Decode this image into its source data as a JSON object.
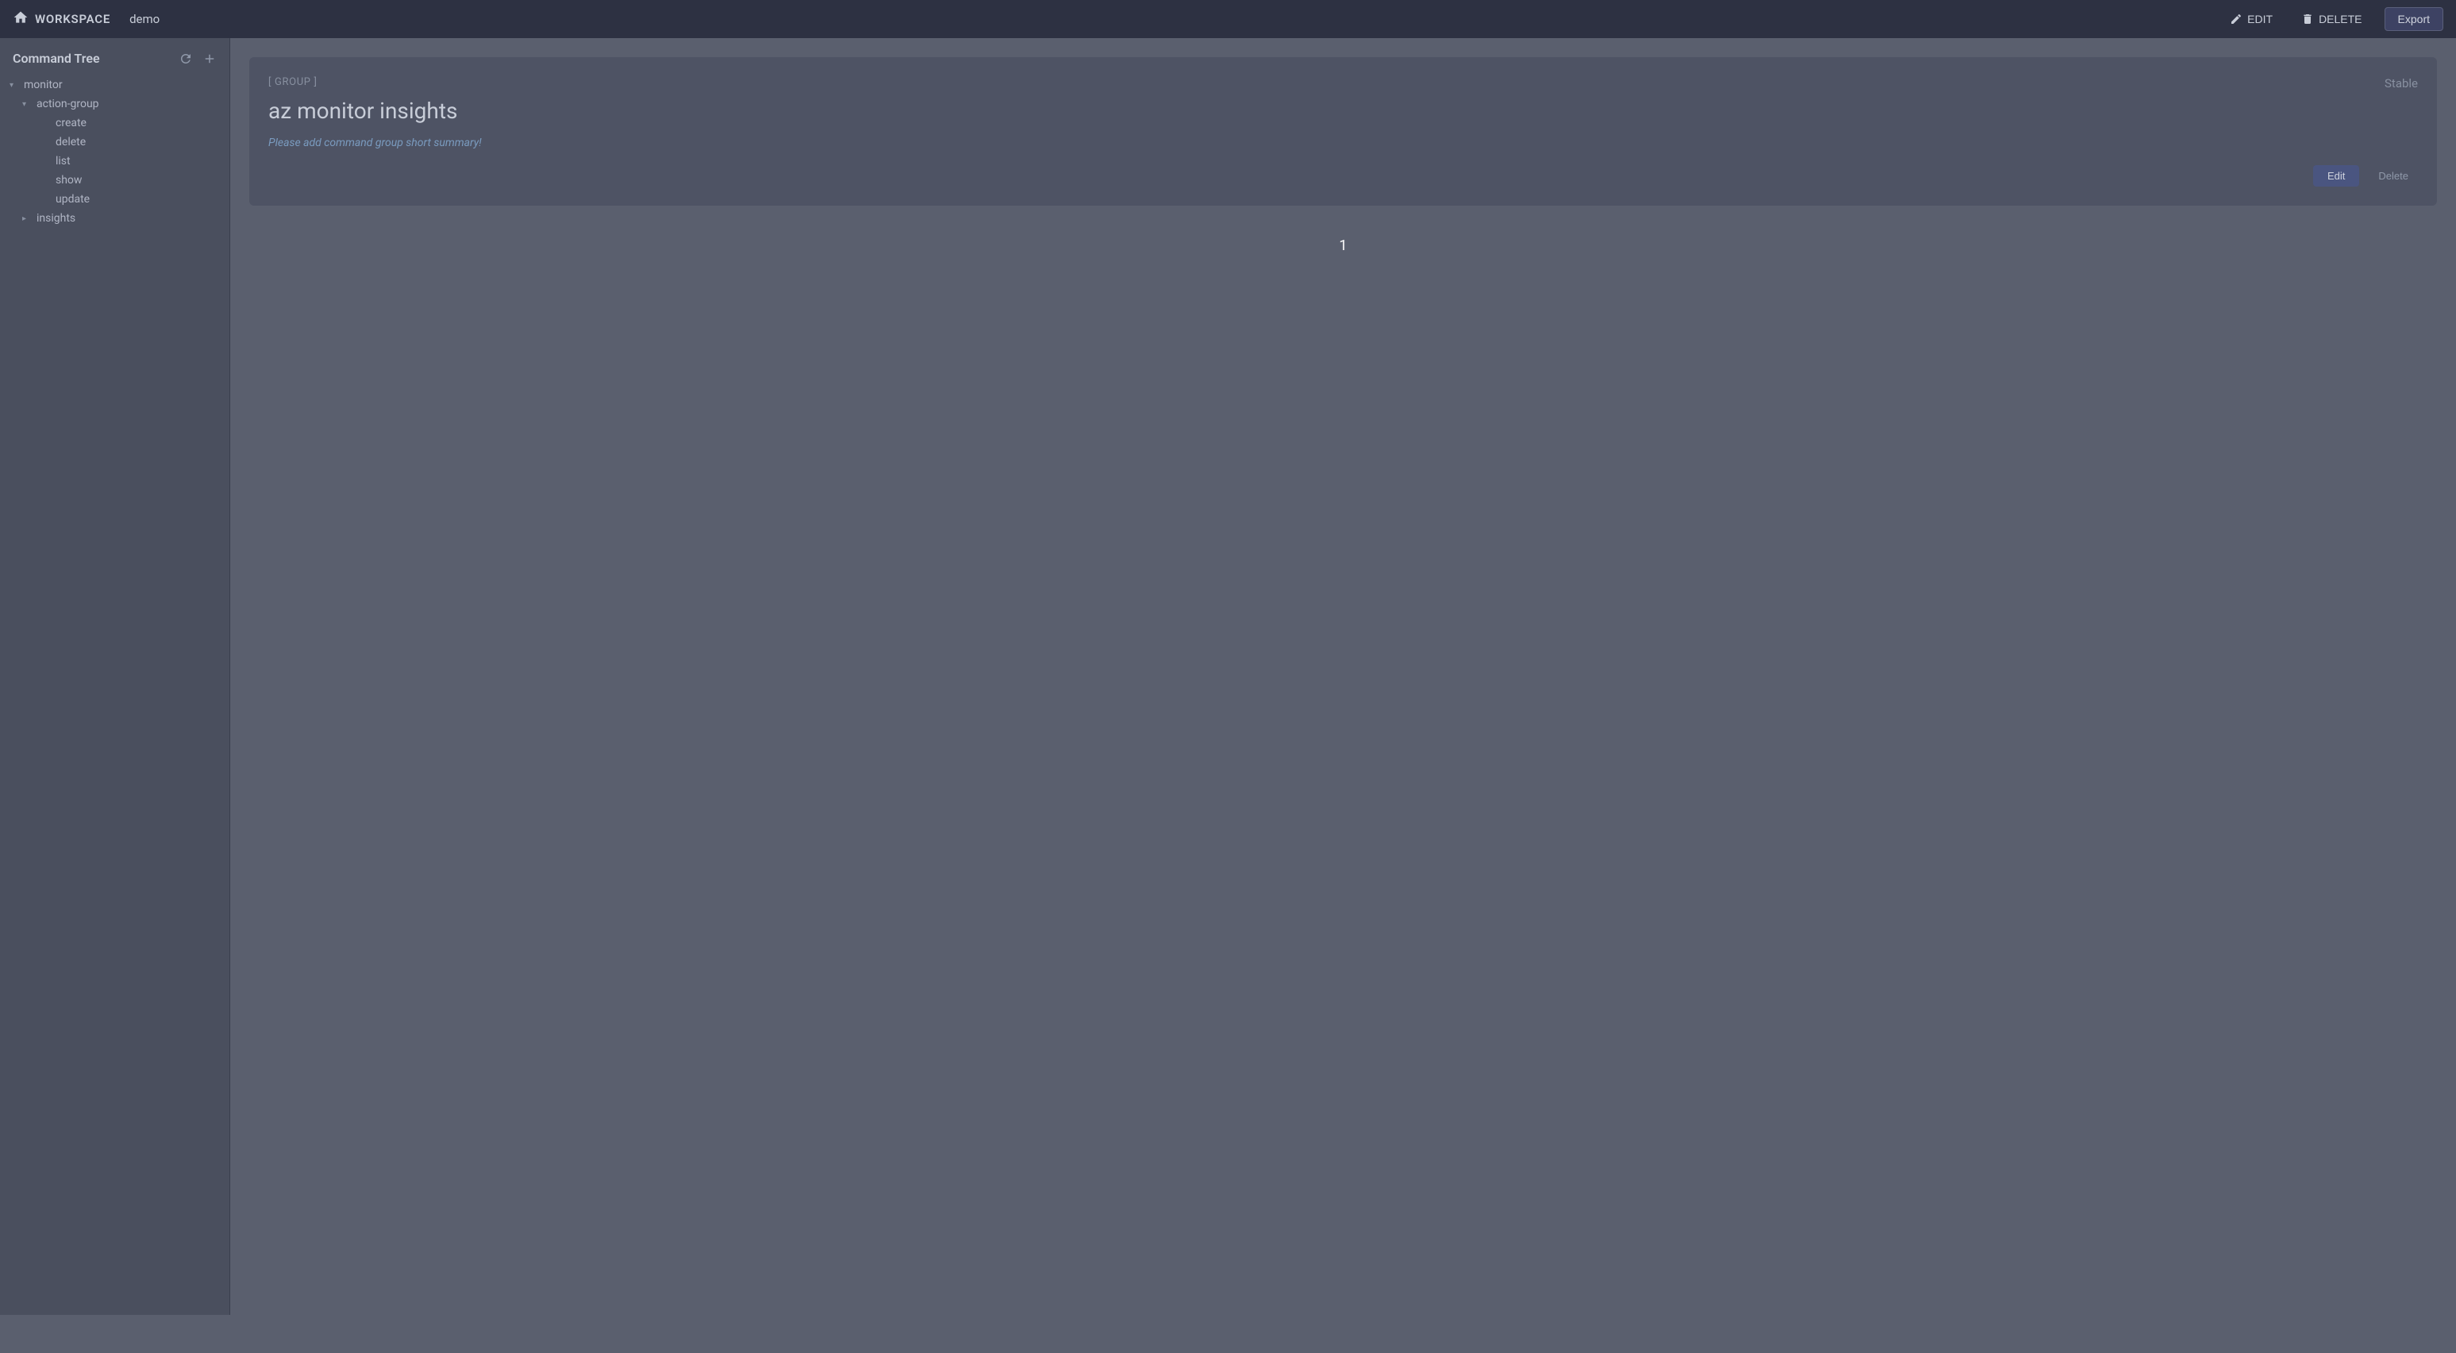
{
  "navbar": {
    "workspace_label": "WORKSPACE",
    "demo_label": "demo",
    "edit_label": "EDIT",
    "delete_label": "DELETE",
    "export_label": "Export"
  },
  "sidebar": {
    "title": "Command Tree",
    "tree": [
      {
        "id": "monitor",
        "label": "monitor",
        "level": 0,
        "hasChevron": true,
        "expanded": true
      },
      {
        "id": "action-group",
        "label": "action-group",
        "level": 1,
        "hasChevron": true,
        "expanded": true
      },
      {
        "id": "create",
        "label": "create",
        "level": 2,
        "hasChevron": false,
        "expanded": false
      },
      {
        "id": "delete",
        "label": "delete",
        "level": 2,
        "hasChevron": false,
        "expanded": false
      },
      {
        "id": "list",
        "label": "list",
        "level": 2,
        "hasChevron": false,
        "expanded": false
      },
      {
        "id": "show",
        "label": "show",
        "level": 2,
        "hasChevron": false,
        "expanded": false
      },
      {
        "id": "update",
        "label": "update",
        "level": 2,
        "hasChevron": false,
        "expanded": false
      },
      {
        "id": "insights",
        "label": "insights",
        "level": 1,
        "hasChevron": true,
        "expanded": false
      }
    ]
  },
  "main": {
    "group_label": "[ GROUP ]",
    "stable_label": "Stable",
    "title": "az monitor insights",
    "placeholder_text": "Please add command group short summary!",
    "edit_button": "Edit",
    "delete_button": "Delete",
    "page_number": "1"
  }
}
